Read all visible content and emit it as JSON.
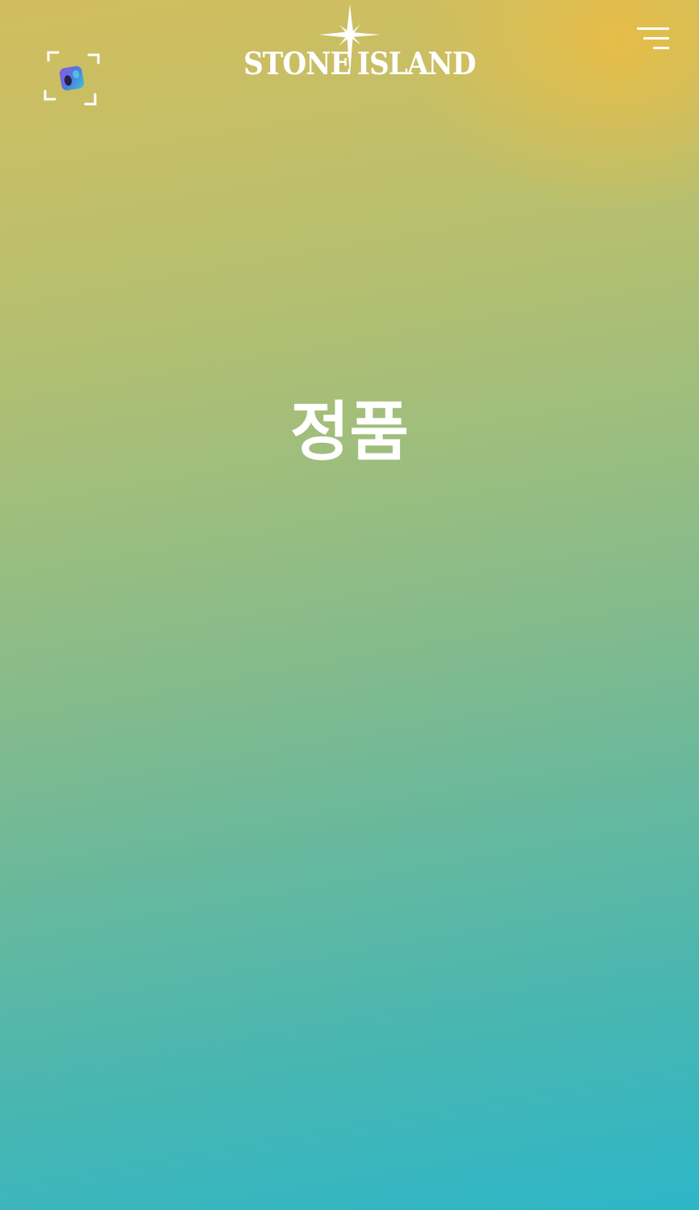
{
  "header": {
    "brand_left": "STONE",
    "brand_right": "ISLAND",
    "scanner_icon": "ar-scan-icon",
    "menu_icon": "hamburger-menu-icon"
  },
  "main": {
    "title": "정품"
  },
  "colors": {
    "gradient_top": "#d2bd5e",
    "gradient_bottom": "#2db6c8",
    "corner_glow": "#ecbc42",
    "foreground": "#ffffff"
  }
}
